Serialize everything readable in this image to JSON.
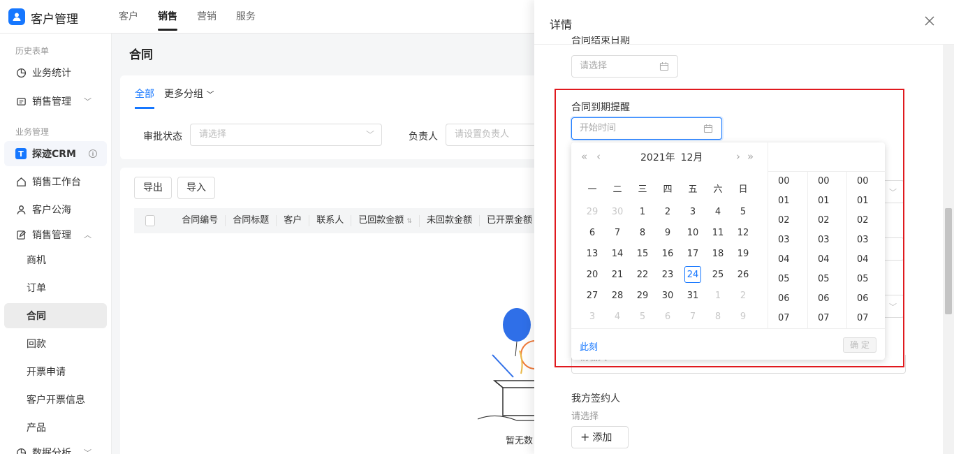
{
  "app": {
    "title": "客户管理"
  },
  "topnav": {
    "tabs": [
      "客户",
      "销售",
      "营销",
      "服务"
    ],
    "active": "销售"
  },
  "sidebar": {
    "section_history": "历史表单",
    "section_business": "业务管理",
    "items": {
      "biz_stats": "业务统计",
      "sales_mgmt_top": "销售管理",
      "crm": "探迹CRM",
      "workbench": "销售工作台",
      "public_pool": "客户公海",
      "sales_mgmt": "销售管理",
      "opportunity": "商机",
      "orders": "订单",
      "contracts": "合同",
      "payments": "回款",
      "invoice_apply": "开票申请",
      "customer_invoice": "客户开票信息",
      "products": "产品",
      "data_analysis": "数据分析"
    }
  },
  "main": {
    "title": "合同",
    "tabs": {
      "all": "全部",
      "more": "更多分组"
    },
    "filters": {
      "approval_label": "审批状态",
      "approval_placeholder": "请选择",
      "owner_label": "负责人",
      "owner_placeholder": "请设置负责人"
    },
    "buttons": {
      "export": "导出",
      "import": "导入"
    },
    "columns": [
      "合同编号",
      "合同标题",
      "客户",
      "联系人",
      "已回款金额",
      "未回款金额",
      "已开票金额"
    ],
    "empty_text": "暂无数"
  },
  "drawer": {
    "title": "详情",
    "end_date_label": "合同结束日期",
    "end_date_placeholder": "请选择",
    "reminder_label": "合同到期提醒",
    "reminder_placeholder": "开始时间",
    "partial_input_text": "请输入",
    "signer_label": "我方签约人",
    "signer_hint": "请选择",
    "add_label": "添加"
  },
  "calendar": {
    "year": "2021年",
    "month": "12月",
    "weekdays": [
      "一",
      "二",
      "三",
      "四",
      "五",
      "六",
      "日"
    ],
    "days": [
      {
        "d": "29",
        "m": true
      },
      {
        "d": "30",
        "m": true
      },
      {
        "d": "1"
      },
      {
        "d": "2"
      },
      {
        "d": "3"
      },
      {
        "d": "4"
      },
      {
        "d": "5"
      },
      {
        "d": "6"
      },
      {
        "d": "7"
      },
      {
        "d": "8"
      },
      {
        "d": "9"
      },
      {
        "d": "10"
      },
      {
        "d": "11"
      },
      {
        "d": "12"
      },
      {
        "d": "13"
      },
      {
        "d": "14"
      },
      {
        "d": "15"
      },
      {
        "d": "16"
      },
      {
        "d": "17"
      },
      {
        "d": "18"
      },
      {
        "d": "19"
      },
      {
        "d": "20"
      },
      {
        "d": "21"
      },
      {
        "d": "22"
      },
      {
        "d": "23"
      },
      {
        "d": "24",
        "today": true
      },
      {
        "d": "25"
      },
      {
        "d": "26"
      },
      {
        "d": "27"
      },
      {
        "d": "28"
      },
      {
        "d": "29"
      },
      {
        "d": "30"
      },
      {
        "d": "31"
      },
      {
        "d": "1",
        "m": true
      },
      {
        "d": "2",
        "m": true
      },
      {
        "d": "3",
        "m": true
      },
      {
        "d": "4",
        "m": true
      },
      {
        "d": "5",
        "m": true
      },
      {
        "d": "6",
        "m": true
      },
      {
        "d": "7",
        "m": true
      },
      {
        "d": "8",
        "m": true
      },
      {
        "d": "9",
        "m": true
      }
    ],
    "time_values": [
      "00",
      "01",
      "02",
      "03",
      "04",
      "05",
      "06",
      "07"
    ],
    "now_label": "此刻",
    "ok_label": "确 定"
  },
  "colors": {
    "accent": "#1677ff",
    "highlight": "#e0191e"
  }
}
